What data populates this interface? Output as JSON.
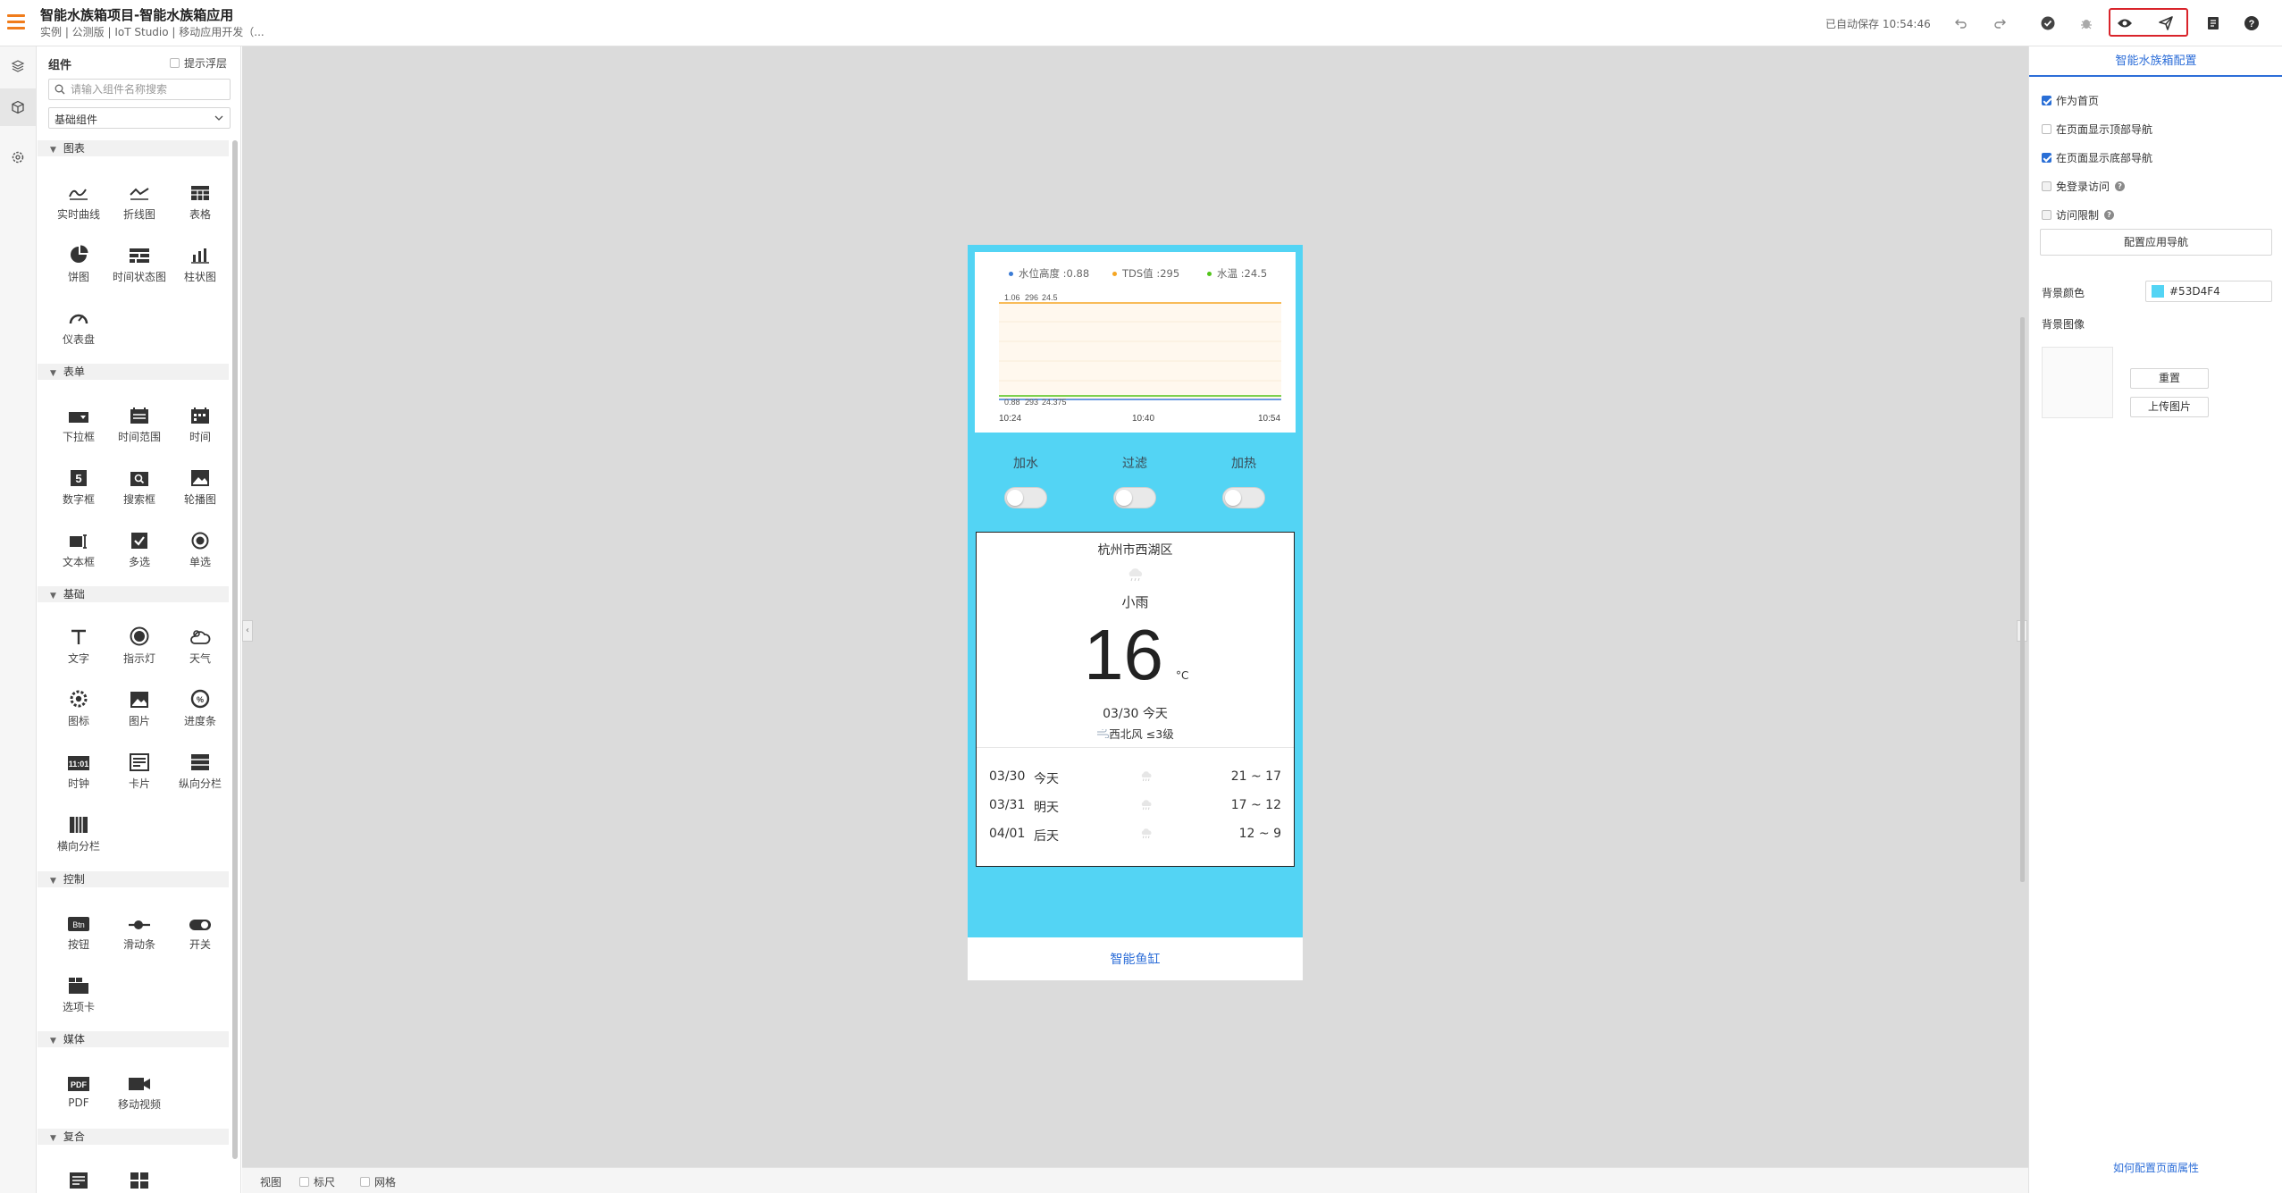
{
  "header": {
    "title": "智能水族箱项目-智能水族箱应用",
    "subtitle": "实例 | 公测版 | IoT Studio | 移动应用开发（...",
    "autosave": "已自动保存 10:54:46"
  },
  "panel": {
    "title": "组件",
    "float_tip": "提示浮层",
    "search_placeholder": "请输入组件名称搜索",
    "select_value": "基础组件",
    "categories": [
      {
        "name": "图表",
        "items": [
          "实时曲线",
          "折线图",
          "表格",
          "饼图",
          "时间状态图",
          "柱状图",
          "仪表盘"
        ]
      },
      {
        "name": "表单",
        "items": [
          "下拉框",
          "时间范围",
          "时间",
          "数字框",
          "搜索框",
          "轮播图",
          "文本框",
          "多选",
          "单选"
        ]
      },
      {
        "name": "基础",
        "items": [
          "文字",
          "指示灯",
          "天气",
          "图标",
          "图片",
          "进度条",
          "时钟",
          "卡片",
          "纵向分栏",
          "横向分栏"
        ]
      },
      {
        "name": "控制",
        "items": [
          "按钮",
          "滑动条",
          "开关",
          "选项卡"
        ]
      },
      {
        "name": "媒体",
        "items": [
          "PDF",
          "移动视频"
        ]
      },
      {
        "name": "复合",
        "items": []
      }
    ]
  },
  "chart_data": {
    "type": "line",
    "legend": [
      {
        "name": "水位高度",
        "last": ":0.88",
        "color": "#3a7bd5"
      },
      {
        "name": "TDS值",
        "last": ":295",
        "color": "#f5a623"
      },
      {
        "name": "水温",
        "last": ":24.5",
        "color": "#52c41a"
      }
    ],
    "top_labels": [
      "1.06",
      "296",
      "24.5"
    ],
    "bottom_labels": [
      "0.88",
      "293",
      "24.375"
    ],
    "x_ticks": [
      "10:24",
      "10:40",
      "10:54"
    ]
  },
  "phone": {
    "toggles": [
      {
        "label": "加水",
        "on": false
      },
      {
        "label": "过滤",
        "on": false
      },
      {
        "label": "加热",
        "on": false
      }
    ],
    "weather": {
      "city": "杭州市西湖区",
      "condition": "小雨",
      "temp": "16",
      "unit": "°C",
      "date": "03/30 今天",
      "wind": "西北风  ≤3级",
      "forecast": [
        {
          "date": "03/30",
          "day": "今天",
          "temp": "21 ~ 17"
        },
        {
          "date": "03/31",
          "day": "明天",
          "temp": "17 ~ 12"
        },
        {
          "date": "04/01",
          "day": "后天",
          "temp": "12 ~ 9"
        }
      ]
    },
    "tab": "智能鱼缸",
    "bg_color": "#53d4f4"
  },
  "bottombar": {
    "view": "视图",
    "ruler": "标尺",
    "grid": "网格"
  },
  "rpanel": {
    "title": "智能水族箱配置",
    "checks": [
      {
        "label": "作为首页",
        "checked": true
      },
      {
        "label": "在页面显示顶部导航",
        "checked": false
      },
      {
        "label": "在页面显示底部导航",
        "checked": true
      },
      {
        "label": "免登录访问",
        "checked": false
      },
      {
        "label": "访问限制",
        "checked": false
      }
    ],
    "nav_button": "配置应用导航",
    "bg_color_label": "背景颜色",
    "bg_color_value": "#53D4F4",
    "bg_image_label": "背景图像",
    "reset": "重置",
    "upload": "上传图片",
    "help": "如何配置页面属性"
  }
}
